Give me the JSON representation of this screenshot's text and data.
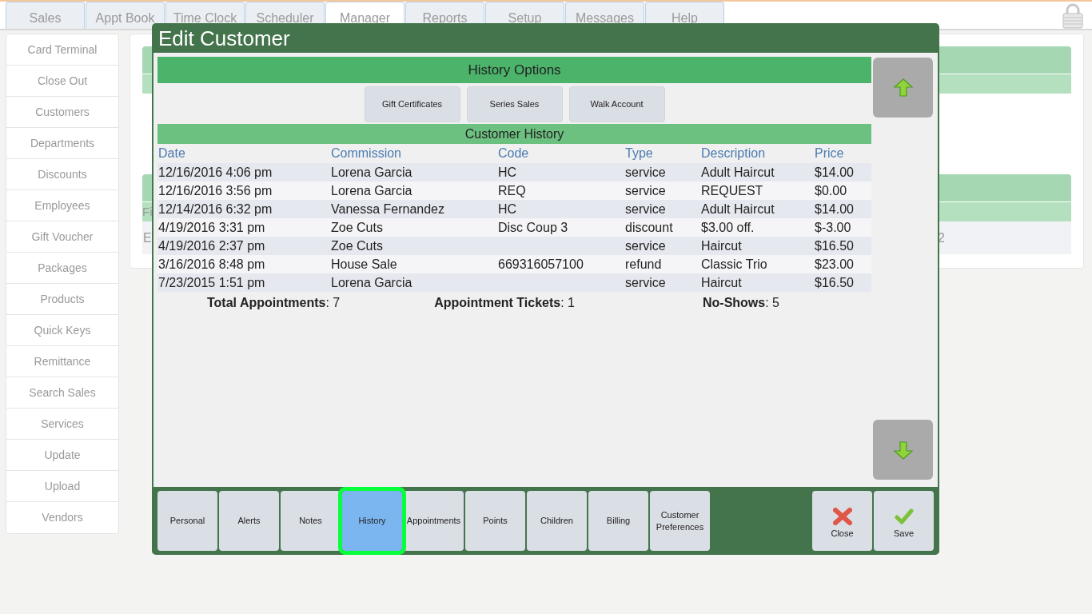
{
  "top_tabs": [
    {
      "label": "Sales",
      "selected": false
    },
    {
      "label": "Appt Book",
      "selected": false
    },
    {
      "label": "Time Clock",
      "selected": false
    },
    {
      "label": "Scheduler",
      "selected": false
    },
    {
      "label": "Manager",
      "selected": true
    },
    {
      "label": "Reports",
      "selected": false
    },
    {
      "label": "Setup",
      "selected": false
    },
    {
      "label": "Messages",
      "selected": false
    },
    {
      "label": "Help",
      "selected": false
    }
  ],
  "sidebar": {
    "items": [
      "Card Terminal",
      "Close Out",
      "Customers",
      "Departments",
      "Discounts",
      "Employees",
      "Gift Voucher",
      "Packages",
      "Products",
      "Quick Keys",
      "Remittance",
      "Search Sales",
      "Services",
      "Update",
      "Upload",
      "Vendors"
    ]
  },
  "background_panel": {
    "subheader_text": "Fi",
    "row_left_text": "E",
    "row_right_text": "2"
  },
  "modal": {
    "title": "Edit Customer",
    "history_options": {
      "title": "History Options",
      "buttons": [
        "Gift Certificates",
        "Series Sales",
        "Walk Account"
      ]
    },
    "customer_history": {
      "title": "Customer History",
      "columns": [
        "Date",
        "Commission",
        "Code",
        "Type",
        "Description",
        "Price"
      ],
      "rows": [
        [
          "12/16/2016 4:06 pm",
          "Lorena Garcia",
          "HC",
          "service",
          "Adult Haircut",
          "$14.00"
        ],
        [
          "12/16/2016 3:56 pm",
          "Lorena Garcia",
          "REQ",
          "service",
          "REQUEST",
          "$0.00"
        ],
        [
          "12/14/2016 6:32 pm",
          "Vanessa Fernandez",
          "HC",
          "service",
          "Adult Haircut",
          "$14.00"
        ],
        [
          "4/19/2016 3:31 pm",
          "Zoe Cuts",
          "Disc Coup 3",
          "discount",
          "$3.00 off.",
          "$-3.00"
        ],
        [
          "4/19/2016 2:37 pm",
          "Zoe Cuts",
          "",
          "service",
          "Haircut",
          "$16.50"
        ],
        [
          "3/16/2016 8:48 pm",
          "House Sale",
          "669316057100",
          "refund",
          "Classic Trio",
          "$23.00"
        ],
        [
          "7/23/2015 1:51 pm",
          "Lorena Garcia",
          "",
          "service",
          "Haircut",
          "$16.50"
        ]
      ]
    },
    "totals": [
      "**Total Appointments**: 7",
      "**Appointment Tickets**: 1",
      "**No-Shows**: 5"
    ],
    "bottom_tabs": [
      {
        "label": "Personal",
        "selected": false
      },
      {
        "label": "Alerts",
        "selected": false
      },
      {
        "label": "Notes",
        "selected": false
      },
      {
        "label": "History",
        "selected": true
      },
      {
        "label": "Appointments",
        "selected": false
      },
      {
        "label": "Points",
        "selected": false
      },
      {
        "label": "Children",
        "selected": false
      },
      {
        "label": "Billing",
        "selected": false
      },
      {
        "label": "Customer Preferences",
        "selected": false
      }
    ],
    "actions": [
      {
        "label": "Close",
        "kind": "close"
      },
      {
        "label": "Save",
        "kind": "save"
      }
    ]
  }
}
